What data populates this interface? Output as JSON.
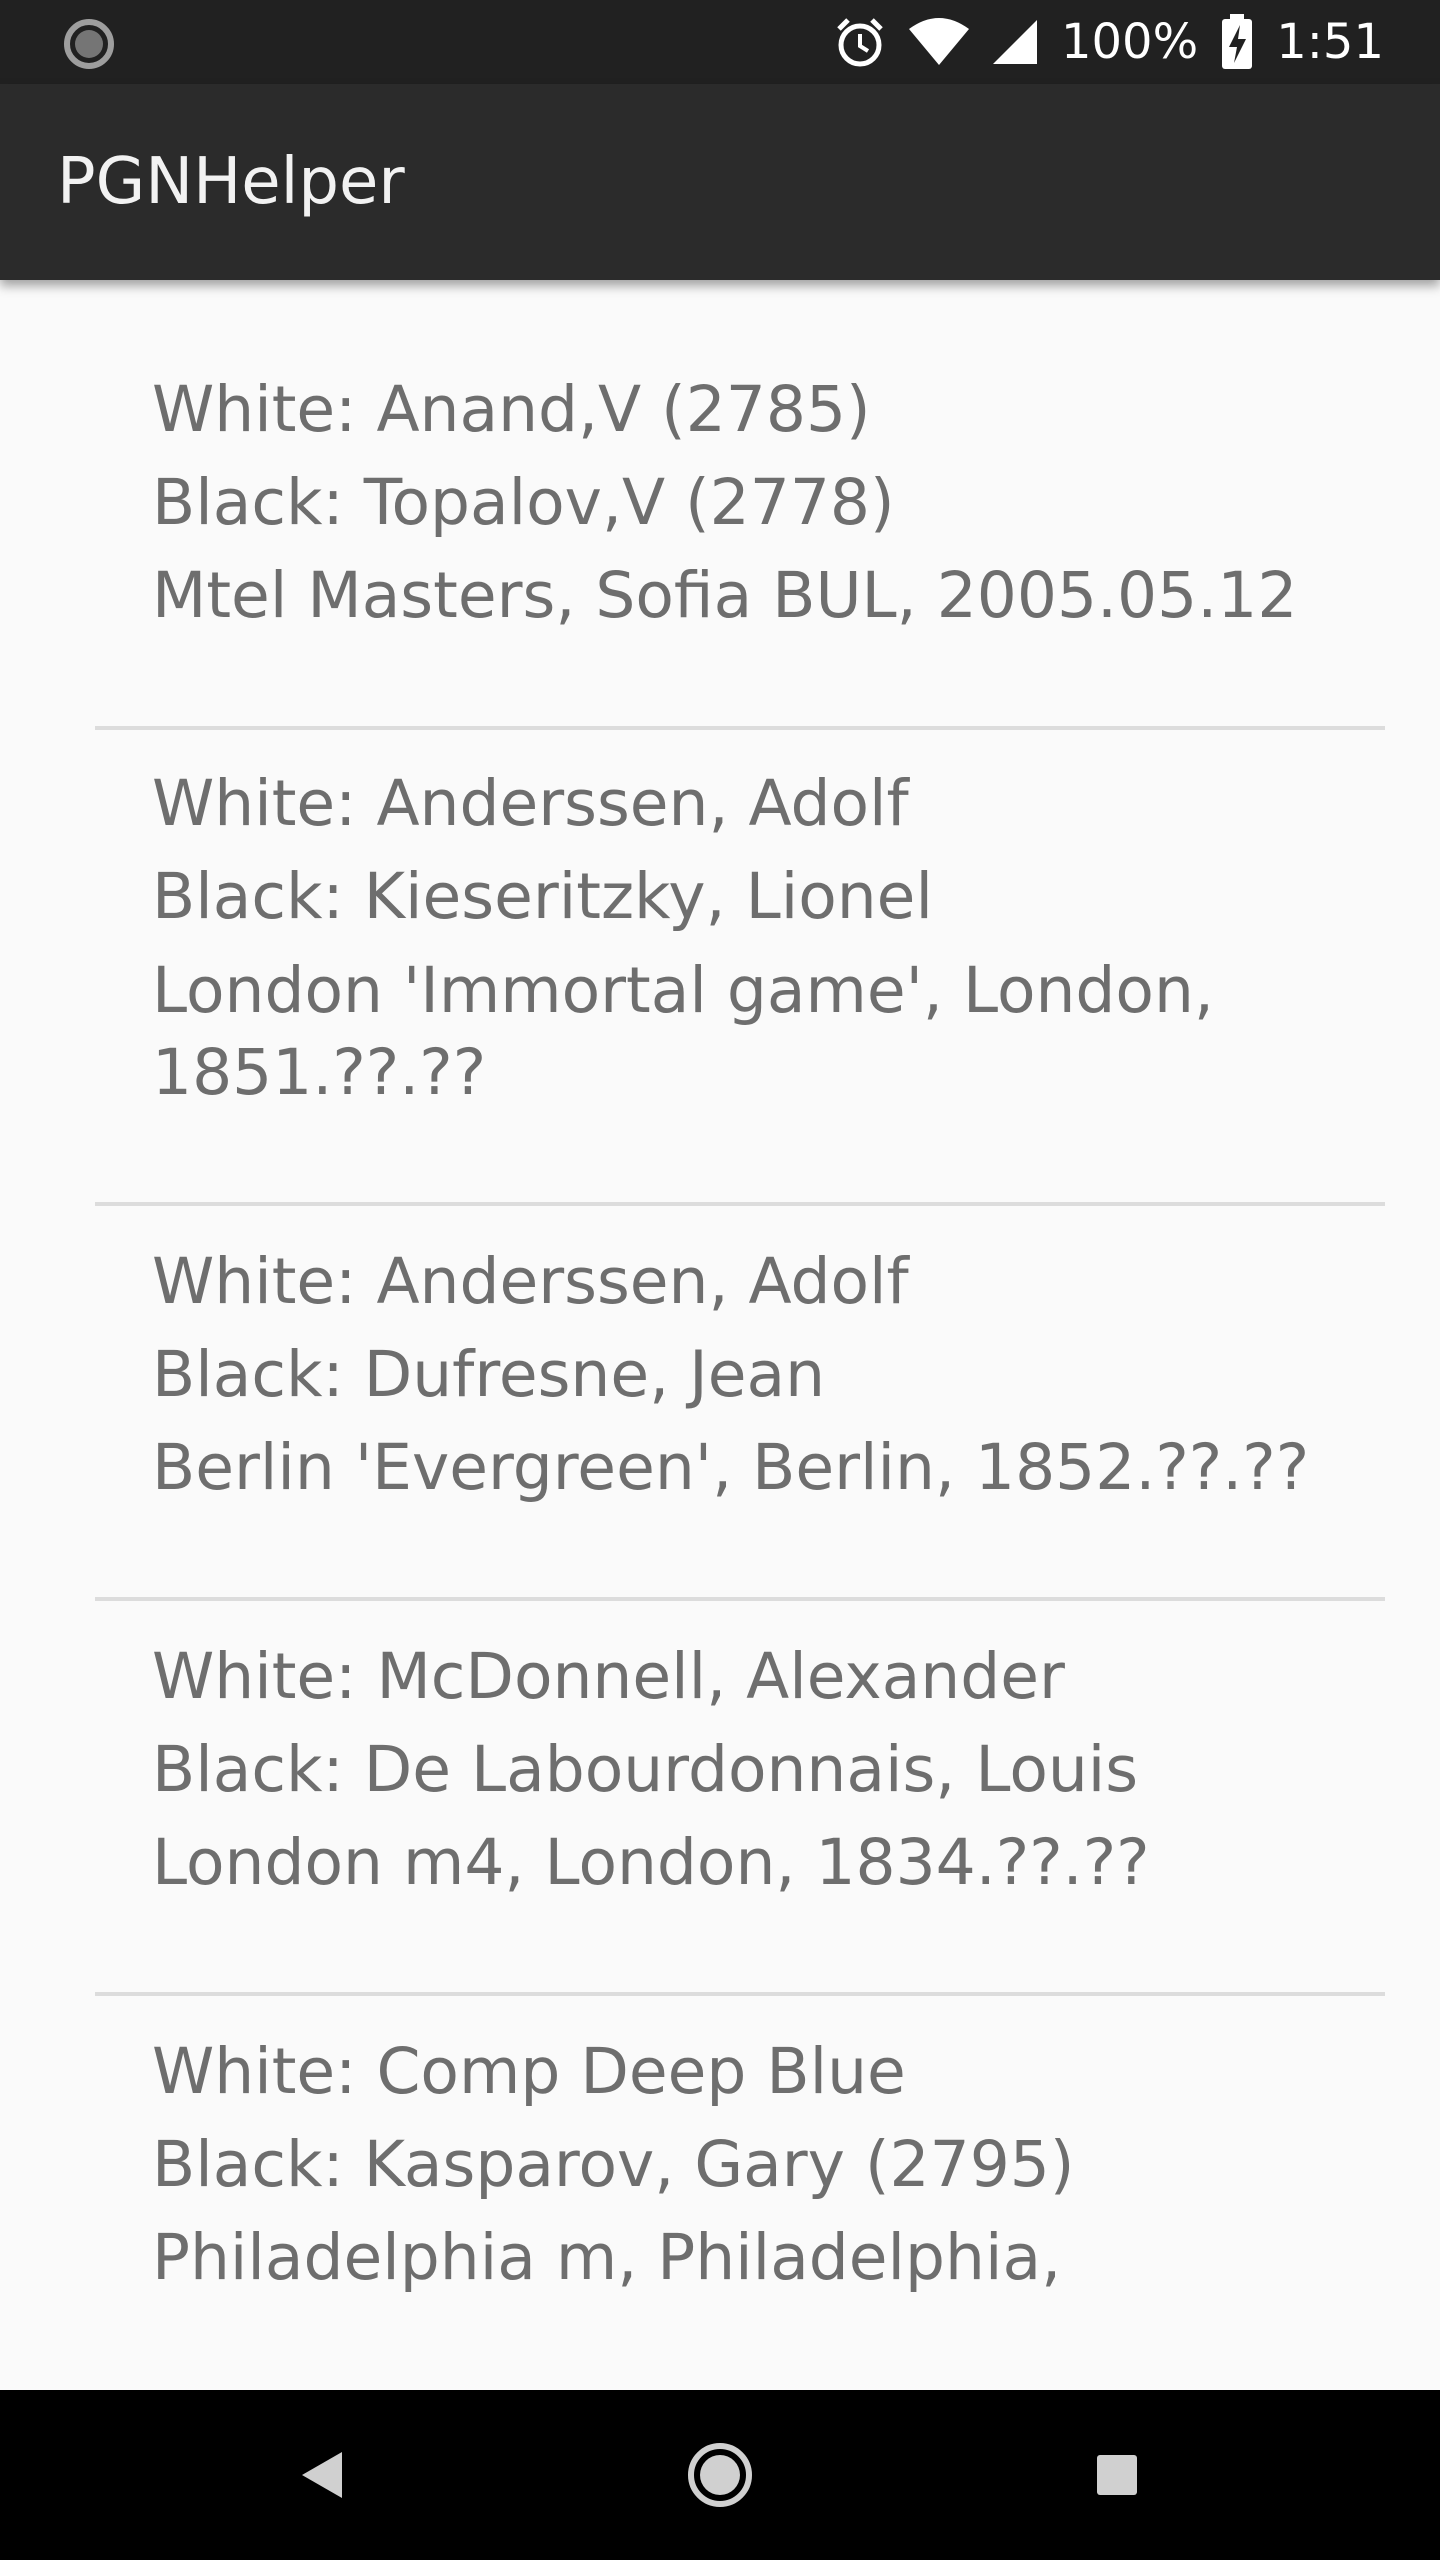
{
  "status_bar": {
    "battery": "100%",
    "time": "1:51",
    "icons": [
      "loading-spinner-icon",
      "alarm-clock-icon",
      "wifi-icon",
      "cell-signal-icon",
      "battery-charging-icon"
    ]
  },
  "app_bar": {
    "title": "PGNHelper"
  },
  "games": [
    {
      "white": "White: Anand,V (2785)",
      "black": "Black: Topalov,V (2778)",
      "event": "Mtel Masters, Sofia BUL, 2005.05.12"
    },
    {
      "white": "White: Anderssen, Adolf",
      "black": "Black: Kieseritzky, Lionel",
      "event": "London 'Immortal game', London, 1851.??.??"
    },
    {
      "white": "White: Anderssen, Adolf",
      "black": "Black: Dufresne, Jean",
      "event": "Berlin 'Evergreen', Berlin, 1852.??.??"
    },
    {
      "white": "White: McDonnell, Alexander",
      "black": "Black: De Labourdonnais, Louis",
      "event": "London m4, London, 1834.??.??"
    },
    {
      "white": "White: Comp Deep Blue",
      "black": "Black: Kasparov, Gary (2795)",
      "event": "Philadelphia m, Philadelphia,"
    }
  ],
  "nav_bar": {
    "icons": [
      "back-icon",
      "home-icon",
      "recents-icon"
    ]
  }
}
